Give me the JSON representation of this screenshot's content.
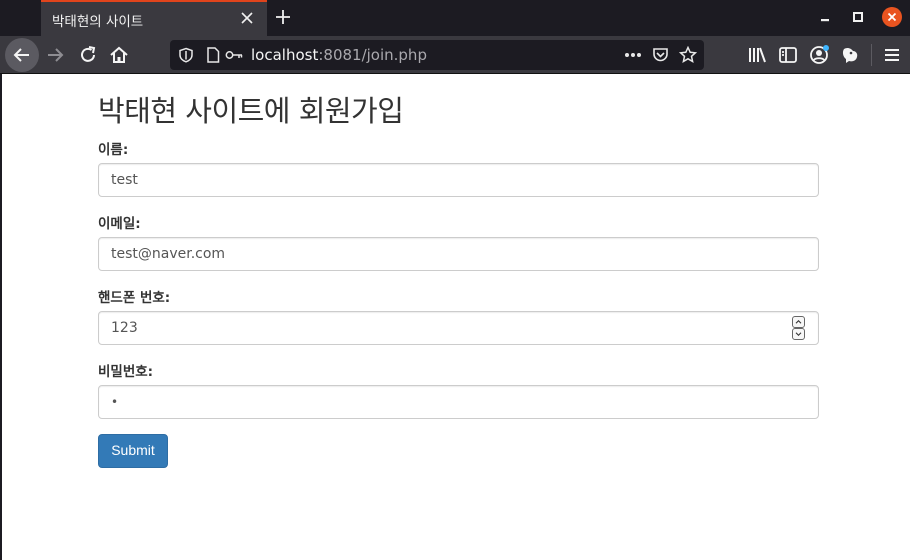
{
  "browser": {
    "tab_title": "박태현의 사이트",
    "url_host": "localhost",
    "url_rest": ":8081/join.php",
    "icons": [
      "tab-close-icon",
      "new-tab-icon",
      "minimize-icon",
      "maximize-icon",
      "window-close-icon",
      "back-icon",
      "forward-icon",
      "reload-icon",
      "home-icon",
      "shield-icon",
      "page-icon",
      "key-icon",
      "more-icon",
      "pocket-icon",
      "bookmark-star-icon",
      "library-icon",
      "sidebar-icon",
      "account-icon",
      "extension-icon",
      "menu-icon"
    ],
    "colors": {
      "accent": "#e0441c",
      "chrome_dark": "#1c1b22",
      "chrome": "#3a393f"
    }
  },
  "page": {
    "title": "박태현 사이트에 회원가입",
    "form": {
      "name_label": "이름:",
      "name_value": "test",
      "email_label": "이메일:",
      "email_value": "test@naver.com",
      "phone_label": "핸드폰 번호:",
      "phone_value": "123",
      "password_label": "비밀번호:",
      "password_value": "•",
      "submit_label": "Submit"
    },
    "colors": {
      "button": "#337ab7",
      "text": "#333333"
    }
  }
}
